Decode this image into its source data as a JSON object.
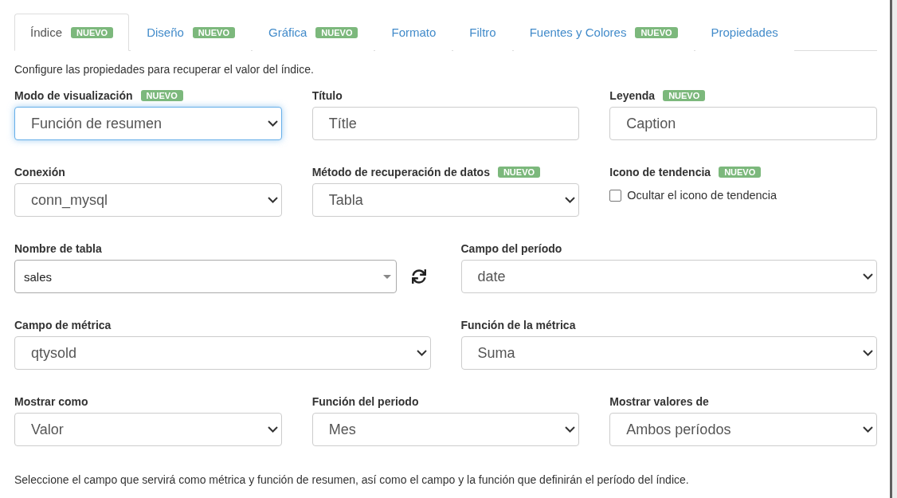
{
  "tabs": [
    {
      "label": "Índice",
      "badge": "NUEVO",
      "selected": true
    },
    {
      "label": "Diseño",
      "badge": "NUEVO",
      "selected": false
    },
    {
      "label": "Gráfica",
      "badge": "NUEVO",
      "selected": false
    },
    {
      "label": "Formato",
      "selected": false
    },
    {
      "label": "Filtro",
      "selected": false
    },
    {
      "label": "Fuentes y Colores",
      "badge": "NUEVO",
      "selected": false
    },
    {
      "label": "Propiedades",
      "selected": false
    }
  ],
  "intro": "Configure las propiedades para recuperar el valor del índice.",
  "rows": [
    {
      "fields": [
        {
          "kind": "select",
          "label": "Modo de visualización",
          "badge": "NUEVO",
          "value": "Función de resumen",
          "focused": true
        },
        {
          "kind": "text",
          "label": "Título",
          "value": "Títle"
        },
        {
          "kind": "text",
          "label": "Leyenda",
          "badge": "NUEVO",
          "value": "Caption"
        }
      ]
    },
    {
      "fields": [
        {
          "kind": "select",
          "label": "Conexión",
          "value": "conn_mysql",
          "focused": false
        },
        {
          "kind": "select",
          "label": "Método de recuperación de datos",
          "badge": "NUEVO",
          "value": "Tabla",
          "focused": false
        },
        {
          "kind": "checkbox",
          "label": "Icono de tendencia",
          "badge": "NUEVO",
          "option": "Ocultar el icono de tendencia",
          "checked": false
        }
      ]
    },
    {
      "fields": [
        {
          "kind": "combo",
          "label": "Nombre de tabla",
          "value": "sales"
        },
        {
          "kind": "select",
          "label": "Campo del período",
          "value": "date",
          "focused": false
        }
      ]
    },
    {
      "fields": [
        {
          "kind": "select",
          "label": "Campo de métrica",
          "value": "qtysold",
          "focused": false
        },
        {
          "kind": "select",
          "label": "Función de la métrica",
          "value": "Suma",
          "focused": false
        }
      ]
    },
    {
      "fields": [
        {
          "kind": "select",
          "label": "Mostrar como",
          "value": "Valor",
          "focused": false
        },
        {
          "kind": "select",
          "label": "Función del periodo",
          "value": "Mes",
          "focused": false
        },
        {
          "kind": "select",
          "label": "Mostrar valores de",
          "value": "Ambos períodos",
          "focused": false
        }
      ]
    }
  ],
  "footer": "Seleccione el campo que servirá como métrica y función de resumen, así como el campo y la función que definirán el período del índice."
}
